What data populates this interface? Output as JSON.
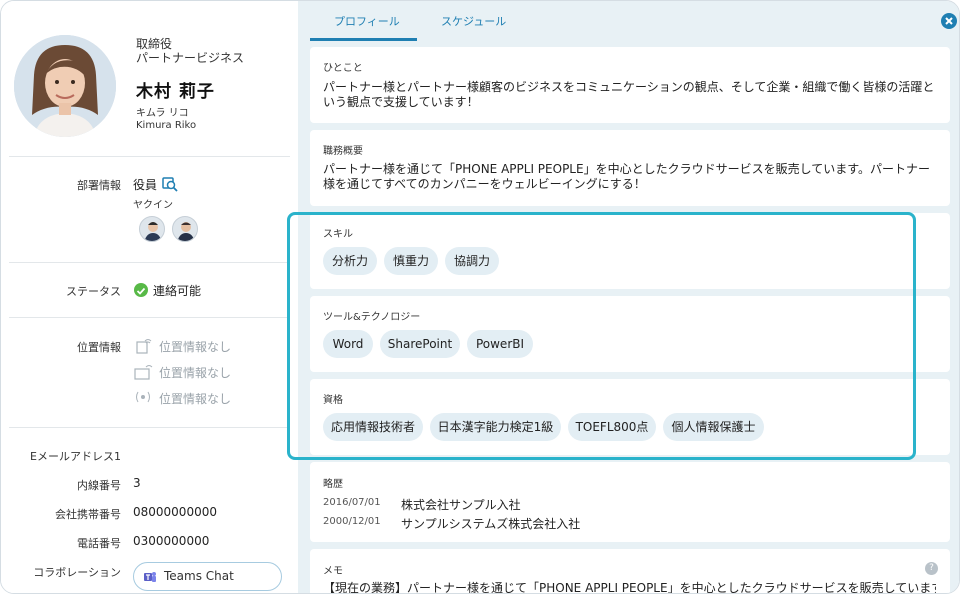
{
  "profile": {
    "title_line1": "取締役",
    "title_line2": "パートナービジネス",
    "name": "木村 莉子",
    "kana": "キムラ リコ",
    "romaji": "Kimura Riko"
  },
  "details": {
    "department_label": "部署情報",
    "department_value": "役員",
    "department_sub": "ヤクイン",
    "status_label": "ステータス",
    "status_value": "連絡可能",
    "location_label": "位置情報",
    "location_items": [
      "位置情報なし",
      "位置情報なし",
      "位置情報なし"
    ],
    "email_label": "Eメールアドレス1",
    "extension_label": "内線番号",
    "extension_value": "3",
    "mobile_label": "会社携帯番号",
    "mobile_value": "08000000000",
    "phone_label": "電話番号",
    "phone_value": "0300000000",
    "collab_label": "コラボレーション",
    "teams_button": "Teams Chat"
  },
  "tabs": [
    "プロフィール",
    "スケジュール"
  ],
  "sections": {
    "hitokoto": {
      "label": "ひとこと",
      "text": "パートナー様とパートナー様顧客のビジネスをコミュニケーションの観点、そして企業・組織で働く皆様の活躍という観点で支援しています！"
    },
    "duties": {
      "label": "職務概要",
      "text": "パートナー様を通じて「PHONE APPLI PEOPLE」を中心としたクラウドサービスを販売しています。パートナー様を通じてすべてのカンパニーをウェルビーイングにする！"
    },
    "skills": {
      "label": "スキル",
      "items": [
        "分析力",
        "慎重力",
        "協調力"
      ]
    },
    "tools": {
      "label": "ツール&テクノロジー",
      "items": [
        "Word",
        "SharePoint",
        "PowerBI"
      ]
    },
    "qualifications": {
      "label": "資格",
      "items": [
        "応用情報技術者",
        "日本漢字能力検定1級",
        "TOEFL800点",
        "個人情報保護士"
      ]
    },
    "history": {
      "label": "略歴",
      "entries": [
        {
          "date": "2016/07/01",
          "company": "株式会社サンプル入社"
        },
        {
          "date": "2000/12/01",
          "company": "サンプルシステムズ株式会社入社"
        }
      ]
    },
    "memo": {
      "label": "メモ",
      "text": "【現在の業務】パートナー様を通じて「PHONE APPLI PEOPLE」を中心としたクラウドサービスを販売しています。"
    }
  },
  "colors": {
    "accent": "#1f7fb2",
    "highlight": "#2ab3cb",
    "status_green": "#58b947",
    "chip_bg": "#e3eef4",
    "panel_bg": "#e8f1f5"
  }
}
